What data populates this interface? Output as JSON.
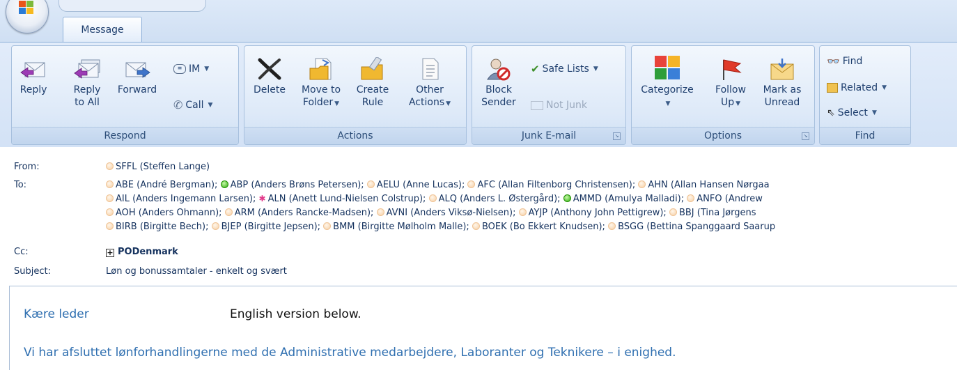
{
  "tab": {
    "label": "Message"
  },
  "ribbon": {
    "respond": {
      "label": "Respond",
      "reply": "Reply",
      "reply_all_1": "Reply",
      "reply_all_2": "to All",
      "forward": "Forward",
      "im": "IM",
      "call": "Call"
    },
    "actions": {
      "label": "Actions",
      "delete": "Delete",
      "move_1": "Move to",
      "move_2": "Folder",
      "rule_1": "Create",
      "rule_2": "Rule",
      "other_1": "Other",
      "other_2": "Actions"
    },
    "junk": {
      "label": "Junk E-mail",
      "block_1": "Block",
      "block_2": "Sender",
      "safe_lists": "Safe Lists",
      "not_junk": "Not Junk"
    },
    "options": {
      "label": "Options",
      "categorize": "Categorize",
      "follow_1": "Follow",
      "follow_2": "Up",
      "mark_1": "Mark as",
      "mark_2": "Unread"
    },
    "find": {
      "label": "Find",
      "find": "Find",
      "related": "Related",
      "select": "Select"
    }
  },
  "header": {
    "from_label": "From:",
    "from": "SFFL (Steffen Lange)",
    "to_label": "To:",
    "to_lines": [
      "ABE (André Bergman);",
      "ABP (Anders Brøns Petersen);",
      "AELU (Anne Lucas);",
      "AFC (Allan Filtenborg Christensen);",
      "AHN (Allan Hansen Nørgaa",
      "AIL (Anders Ingemann Larsen);",
      "ALN (Anett Lund-Nielsen Colstrup);",
      "ALQ (Anders L. Østergård);",
      "AMMD (Amulya Malladi);",
      "ANFO (Andrew",
      "AOH (Anders Ohmann);",
      "ARM (Anders Rancke-Madsen);",
      "AVNI (Anders Viksø-Nielsen);",
      "AYJP (Anthony John Pettigrew);",
      "BBJ (Tina Jørgens",
      "BIRB (Birgitte Bech);",
      "BJEP (Birgitte Jepsen);",
      "BMM (Birgitte Mølholm Malle);",
      "BOEK (Bo Ekkert Knudsen);",
      "BSGG (Bettina Spanggaard Saarup"
    ],
    "cc_label": "Cc:",
    "cc": "PODenmark",
    "subject_label": "Subject:",
    "subject": "Løn og bonussamtaler - enkelt og svært"
  },
  "body": {
    "greeting": "Kære leder",
    "english_note": "English version below.",
    "line1": "Vi har afsluttet lønforhandlingerne med de Administrative medarbejdere, Laboranter og Teknikere – i enighed."
  }
}
